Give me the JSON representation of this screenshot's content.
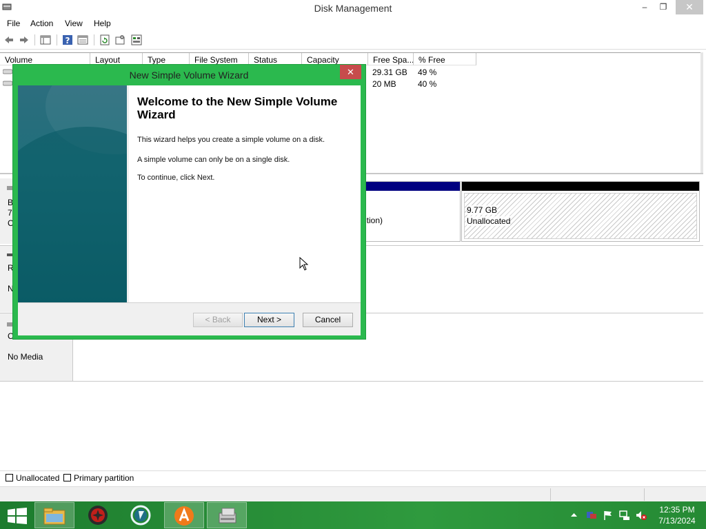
{
  "window": {
    "title": "Disk Management",
    "minimize": "–",
    "maximize": "❐",
    "close": "✕"
  },
  "menu": [
    "File",
    "Action",
    "View",
    "Help"
  ],
  "volume_list": {
    "columns": [
      "Volume",
      "Layout",
      "Type",
      "File System",
      "Status",
      "Capacity",
      "Free Spa...",
      "% Free"
    ],
    "rows": [
      {
        "free_space": "29.31 GB",
        "pct_free": "49 %"
      },
      {
        "free_space": "20 MB",
        "pct_free": "40 %"
      }
    ]
  },
  "disk_area": {
    "disk0_label_fragments": [
      "B",
      "7",
      "C"
    ],
    "partition_text": "ition)",
    "unallocated_size": "9.77 GB",
    "unallocated_label": "Unallocated",
    "disk1_label_fragments": [
      "R",
      "N"
    ],
    "cdrom_label_fragment": "C",
    "no_media": "No Media"
  },
  "legend": [
    {
      "label": "Unallocated",
      "color": "#000000"
    },
    {
      "label": "Primary partition",
      "color": "#000080"
    }
  ],
  "wizard": {
    "title": "New Simple Volume Wizard",
    "close": "✕",
    "heading": "Welcome to the New Simple Volume Wizard",
    "paragraphs": [
      "This wizard helps you create a simple volume on a disk.",
      "A simple volume can only be on a single disk.",
      "To continue, click Next."
    ],
    "back_label": "< Back",
    "next_label": "Next >",
    "cancel_label": "Cancel"
  },
  "taskbar": {
    "apps": [
      "start-icon",
      "file-explorer-icon",
      "red-app-icon",
      "security-app-icon",
      "avast-icon",
      "disk-management-icon"
    ],
    "clock_time": "12:35 PM",
    "clock_date": "7/13/2024"
  },
  "colors": {
    "accent": "#2bb94e",
    "primary_partition": "#000080",
    "taskbar": "#2f9a3e"
  }
}
